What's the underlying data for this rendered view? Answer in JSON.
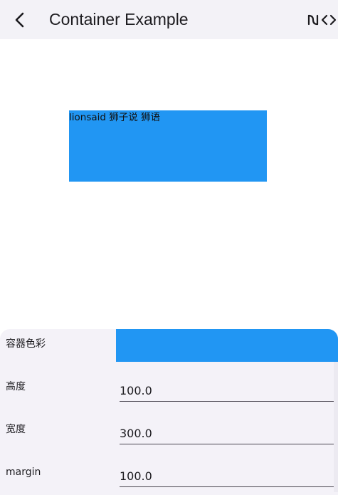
{
  "appbar": {
    "title": "Container Example",
    "back_icon": "arrow-back-icon",
    "actions": [
      "code-branch-icon",
      "code-brackets-icon"
    ]
  },
  "preview": {
    "text": "lionsaid 狮子说 狮语",
    "color": "#2196f3"
  },
  "controls": {
    "color": {
      "label": "容器色彩",
      "value": "#2196f3"
    },
    "height": {
      "label": "高度",
      "value": "100.0"
    },
    "width": {
      "label": "宽度",
      "value": "300.0"
    },
    "margin": {
      "label": "margin",
      "value": "100.0"
    }
  },
  "colors": {
    "appbar_bg": "#f3f2f7",
    "panel_bg": "#f4f2f8",
    "accent": "#2196f3",
    "text": "#1c1b1f"
  }
}
